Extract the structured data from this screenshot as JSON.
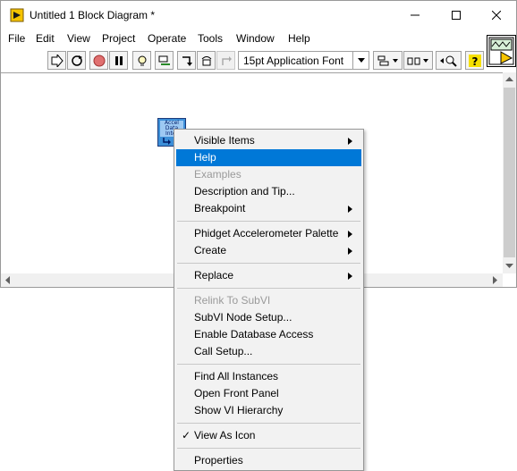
{
  "window": {
    "title": "Untitled 1 Block Diagram *",
    "controls": {
      "minimize": "—",
      "maximize": "☐",
      "close": "✕"
    }
  },
  "menubar": [
    "File",
    "Edit",
    "View",
    "Project",
    "Operate",
    "Tools",
    "Window",
    "Help"
  ],
  "toolbar": {
    "font_select": "15pt Application Font"
  },
  "subvi_icon": {
    "lines": [
      "Accel",
      "Data",
      "Inter"
    ]
  },
  "context_menu": {
    "items": [
      {
        "label": "Visible Items",
        "submenu": true
      },
      {
        "label": "Help",
        "highlighted": true
      },
      {
        "label": "Examples",
        "disabled": true
      },
      {
        "label": "Description and Tip..."
      },
      {
        "label": "Breakpoint",
        "submenu": true
      },
      {
        "label": "Phidget Accelerometer Palette",
        "submenu": true
      },
      {
        "label": "Create",
        "submenu": true
      },
      {
        "label": "Replace",
        "submenu": true
      },
      {
        "label": "Relink To SubVI",
        "disabled": true
      },
      {
        "label": "SubVI Node Setup..."
      },
      {
        "label": "Enable Database Access"
      },
      {
        "label": "Call Setup..."
      },
      {
        "label": "Find All Instances"
      },
      {
        "label": "Open Front Panel"
      },
      {
        "label": "Show VI Hierarchy"
      },
      {
        "label": "View As Icon",
        "checked": true
      },
      {
        "label": "Properties"
      }
    ],
    "check_mark": "✓"
  },
  "colors": {
    "highlight": "#0078d7",
    "subvi_blue": "#3c8fd8"
  }
}
